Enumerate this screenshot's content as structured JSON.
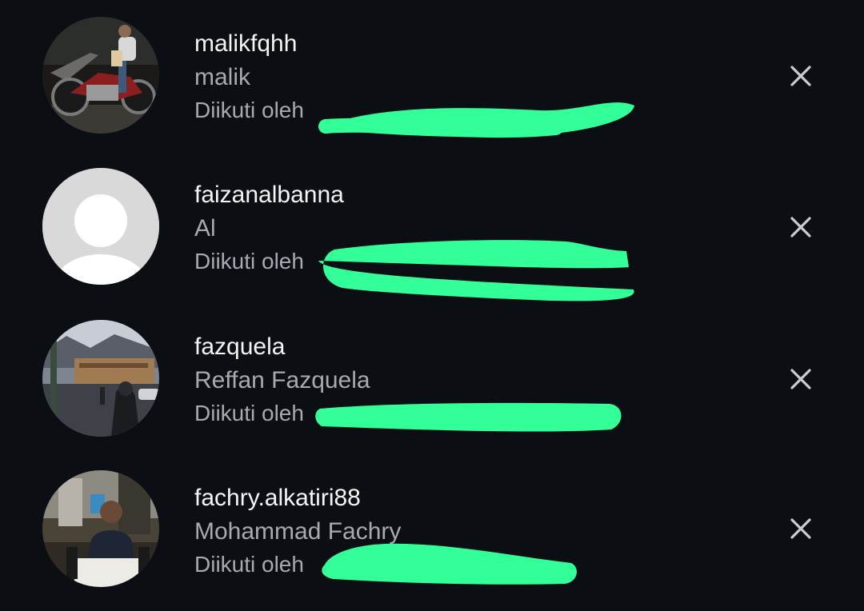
{
  "suggestions": [
    {
      "username": "malikfqhh",
      "full_name": "malik",
      "followed_by": "Diikuti oleh",
      "avatar": "photo-man-on-motorcycle",
      "dismiss_icon": "close-icon"
    },
    {
      "username": "faizanalbanna",
      "full_name": "Al",
      "followed_by": "Diikuti oleh",
      "avatar": "default-user-silhouette",
      "dismiss_icon": "close-icon"
    },
    {
      "username": "fazquela",
      "full_name": "Reffan Fazquela",
      "followed_by": "Diikuti oleh",
      "avatar": "photo-city-street",
      "dismiss_icon": "close-icon"
    },
    {
      "username": "fachry.alkatiri88",
      "full_name": "Mohammad Fachry",
      "followed_by": "Diikuti oleh",
      "avatar": "photo-man-in-restaurant",
      "dismiss_icon": "close-icon"
    }
  ],
  "colors": {
    "background": "#0b0e13",
    "username": "#f5f5f5",
    "secondary_text": "#a7abb1",
    "redaction_marker": "#33ff99",
    "close_icon": "#c9ccd1"
  }
}
